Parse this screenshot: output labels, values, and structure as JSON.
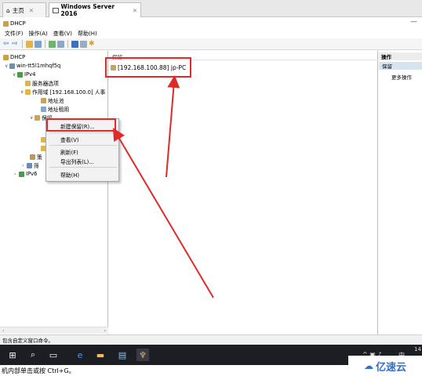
{
  "browser": {
    "tab_home": "主页",
    "tab_active": "Windows Server 2016"
  },
  "window": {
    "title": "DHCP",
    "menus": [
      "文件(F)",
      "操作(A)",
      "查看(V)",
      "帮助(H)"
    ]
  },
  "tree": {
    "root": "DHCP",
    "server": "win-tt5l1mhqf5q",
    "ipv4": "IPv4",
    "server_options": "服务器选项",
    "scope": "作用域 [192.168.100.0] 人事",
    "address_pool": "地址池",
    "address_lease": "地址租用",
    "reservations_partial": "保留",
    "policies_partial": "策",
    "filters_partial": "筛",
    "ipv6": "IPv6"
  },
  "content": {
    "header": "保留",
    "item": "[192.168.100.88] jp-PC"
  },
  "actions": {
    "header": "操作",
    "sub": "保留",
    "more": "更多操作"
  },
  "context_menu": {
    "new_reservation": "新建保留(R)...",
    "view": "查看(V)",
    "refresh": "刷新(F)",
    "export": "导出列表(L)...",
    "help": "帮助(H)"
  },
  "status": "包含自定义窗口命令。",
  "tray": {
    "ime": "中",
    "clock_partial": "14"
  },
  "caption": "机内部单击或按 Ctrl+G。",
  "watermark": "亿速云",
  "colors": {
    "annotation_red": "#e02a2a",
    "taskbar": "#1d1d24",
    "selection": "#d6e4f2"
  }
}
